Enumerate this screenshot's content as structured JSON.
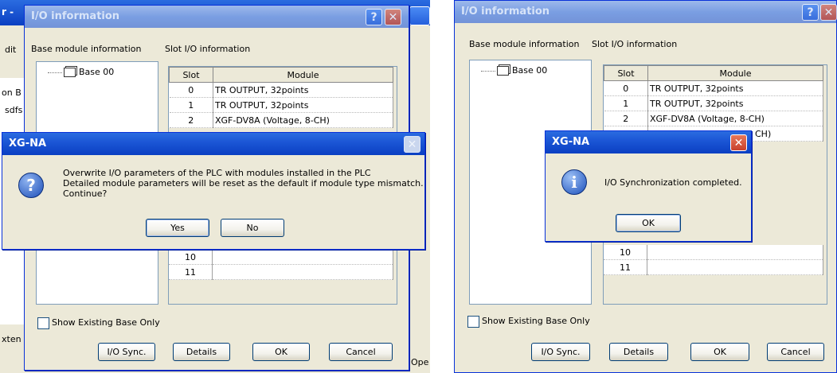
{
  "left": {
    "bg_app": {
      "title_fragment": "r -",
      "menu_fragment": "dit",
      "tree_fragment_1": "on B",
      "tree_fragment_2": "sdfs",
      "bottom_fragment": "xten",
      "status_fragment": "Ope"
    },
    "io_dialog": {
      "title": "I/O information",
      "help_label": "?",
      "close_label": "✕",
      "base_module_label": "Base module information",
      "slot_io_label": "Slot I/O information",
      "tree_item": "Base 00",
      "columns": [
        "Slot",
        "Module"
      ],
      "rows_top": [
        {
          "slot": "0",
          "module": "TR OUTPUT, 32points"
        },
        {
          "slot": "1",
          "module": "TR OUTPUT, 32points"
        },
        {
          "slot": "2",
          "module": "XGF-DV8A (Voltage, 8-CH)"
        }
      ],
      "rows_bottom": [
        {
          "slot": "10",
          "module": ""
        },
        {
          "slot": "11",
          "module": ""
        }
      ],
      "show_existing_label": "Show Existing Base Only",
      "buttons": [
        "I/O Sync.",
        "Details",
        "OK",
        "Cancel"
      ]
    },
    "msgbox": {
      "title": "XG-NA",
      "icon": "question-icon",
      "lines": [
        "Overwrite I/O parameters of the PLC with modules installed in the PLC",
        "Detailed module parameters will be reset as the default if module type mismatch.",
        "Continue?"
      ],
      "yes_label": "Yes",
      "no_label": "No"
    }
  },
  "right": {
    "io_dialog": {
      "title": "I/O information",
      "help_label": "?",
      "close_label": "✕",
      "base_module_label": "Base module information",
      "slot_io_label": "Slot I/O information",
      "tree_item": "Base 00",
      "columns": [
        "Slot",
        "Module"
      ],
      "rows_top": [
        {
          "slot": "0",
          "module": "TR OUTPUT, 32points"
        },
        {
          "slot": "1",
          "module": "TR OUTPUT, 32points"
        },
        {
          "slot": "2",
          "module": "XGF-DV8A (Voltage, 8-CH)"
        },
        {
          "slot": "",
          "module": "CH)"
        }
      ],
      "rows_bottom": [
        {
          "slot": "10",
          "module": ""
        },
        {
          "slot": "11",
          "module": ""
        }
      ],
      "show_existing_label": "Show Existing Base Only",
      "buttons": [
        "I/O Sync.",
        "Details",
        "OK",
        "Cancel"
      ]
    },
    "msgbox": {
      "title": "XG-NA",
      "close_label": "✕",
      "icon": "info-icon",
      "message": "I/O Synchronization completed.",
      "ok_label": "OK"
    }
  }
}
